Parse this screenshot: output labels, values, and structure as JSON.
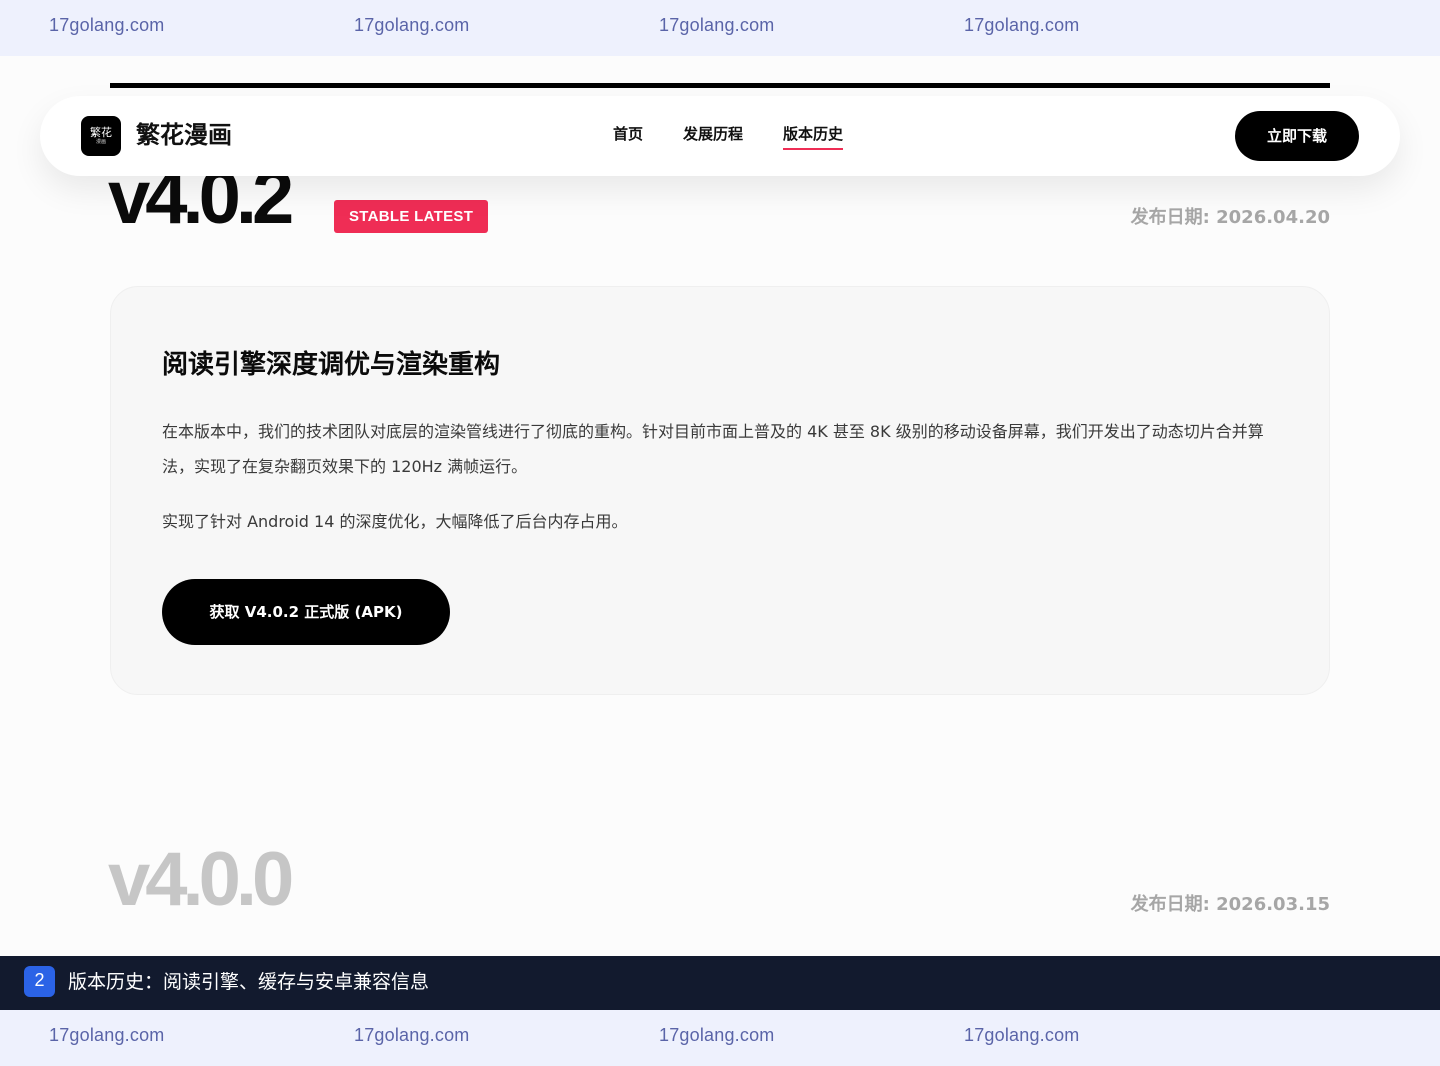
{
  "watermark": {
    "text": "17golang.com"
  },
  "navbar": {
    "logo_main": "繁花",
    "logo_sub": "漫画",
    "brand": "繁花漫画",
    "links": [
      {
        "label": "首页"
      },
      {
        "label": "发展历程"
      },
      {
        "label": "版本历史",
        "active": true
      }
    ],
    "download_label": "立即下载"
  },
  "releases": [
    {
      "version": "v4.0.2",
      "badge": "STABLE LATEST",
      "date": "发布日期: 2026.04.20",
      "card": {
        "title": "阅读引擎深度调优与渲染重构",
        "paragraph1": "在本版本中，我们的技术团队对底层的渲染管线进行了彻底的重构。针对目前市面上普及的 4K 甚至 8K 级别的移动设备屏幕，我们开发出了动态切片合并算法，实现了在复杂翻页效果下的 120Hz 满帧运行。",
        "paragraph2": "实现了针对 Android 14 的深度优化，大幅降低了后台内存占用。",
        "button_label": "获取 V4.0.2 正式版 (APK)"
      }
    },
    {
      "version": "v4.0.0",
      "date": "发布日期: 2026.03.15"
    }
  ],
  "caption": {
    "number": "2",
    "text": "版本历史：阅读引擎、缓存与安卓兼容信息"
  },
  "colors": {
    "accent": "#ef2d55",
    "watermark_bg": "#eef1fd",
    "caption_bg": "#121a2e",
    "caption_badge": "#2b63e6"
  }
}
